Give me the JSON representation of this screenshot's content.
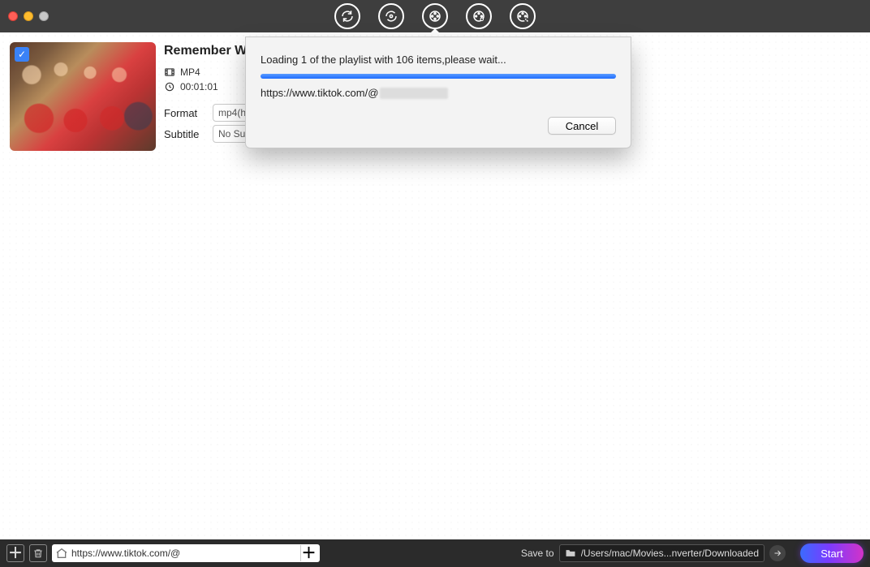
{
  "titlebar": {
    "icons": [
      "refresh-icon",
      "convert-settings-icon",
      "video-reel-icon",
      "video-reel-settings-icon",
      "video-reel-search-icon"
    ]
  },
  "item": {
    "title": "Remember W",
    "format_badge": "MP4",
    "duration": "00:01:01",
    "format_label": "Format",
    "format_value": "mp4(h",
    "subtitle_label": "Subtitle",
    "subtitle_value": "No Subtitle",
    "subtitle_extra": ""
  },
  "modal": {
    "status": "Loading 1 of the playlist with 106 items,please wait...",
    "url_prefix": "https://www.tiktok.com/@",
    "cancel": "Cancel"
  },
  "bottom": {
    "url": "https://www.tiktok.com/@",
    "save_label": "Save to",
    "save_path": "/Users/mac/Movies...nverter/Downloaded",
    "start": "Start"
  }
}
